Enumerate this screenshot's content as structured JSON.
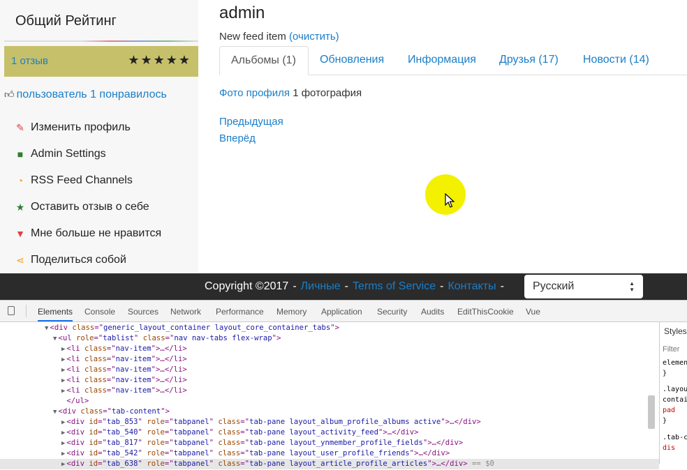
{
  "sidebar": {
    "rating_title": "Общий Рейтинг",
    "review_link": "1 отзыв",
    "stars": "★★★★★",
    "likes_text": "пользователь 1 понравилось",
    "menu": [
      {
        "label": "Изменить профиль",
        "icon": "edit-icon",
        "glyph": "✎",
        "color": "#e04040"
      },
      {
        "label": "Admin Settings",
        "icon": "admin-settings-icon",
        "glyph": "■",
        "color": "#2e7d32"
      },
      {
        "label": "RSS Feed Channels",
        "icon": "rss-icon",
        "glyph": "◔",
        "color": "#f0a020"
      },
      {
        "label": "Оставить отзыв о себе",
        "icon": "star-icon",
        "glyph": "★",
        "color": "#2e7d32"
      },
      {
        "label": "Мне больше не нравится",
        "icon": "thumbs-down-icon",
        "glyph": "▼",
        "color": "#e04040"
      },
      {
        "label": "Поделиться собой",
        "icon": "share-icon",
        "glyph": "⋖",
        "color": "#f0a020"
      }
    ]
  },
  "main": {
    "username": "admin",
    "feed_text": "New feed item",
    "feed_clear": "(очистить)",
    "tabs": [
      "Альбомы (1)",
      "Обновления",
      "Информация",
      "Друзья (17)",
      "Новости (14)"
    ],
    "active_tab": 0,
    "photos_link": "Фото профиля",
    "photos_count": "1 фотография",
    "prev": "Предыдущая",
    "next": "Вперёд"
  },
  "footer": {
    "copyright": "Copyright ©2017",
    "links": [
      "Личные",
      "Terms of Service",
      "Контакты"
    ],
    "language": "Русский"
  },
  "devtools": {
    "tabs": [
      "Elements",
      "Console",
      "Sources",
      "Network",
      "Performance",
      "Memory",
      "Application",
      "Security",
      "Audits",
      "EditThisCookie",
      "Vue"
    ],
    "active_tab": "Elements",
    "dom_lines": [
      {
        "indent": 0,
        "tri": "▼",
        "tag": "div",
        "attrs": [
          [
            "class",
            "generic_layout_container layout_core_container_tabs"
          ]
        ],
        "close": false,
        "ellipsis": false,
        "selected": false
      },
      {
        "indent": 1,
        "tri": "▼",
        "tag": "ul",
        "attrs": [
          [
            "role",
            "tablist"
          ],
          [
            "class",
            "nav nav-tabs flex-wrap"
          ]
        ],
        "close": false,
        "ellipsis": false,
        "selected": false
      },
      {
        "indent": 2,
        "tri": "▶",
        "tag": "li",
        "attrs": [
          [
            "class",
            "nav-item"
          ]
        ],
        "close": true,
        "ellipsis": true,
        "selected": false
      },
      {
        "indent": 2,
        "tri": "▶",
        "tag": "li",
        "attrs": [
          [
            "class",
            "nav-item"
          ]
        ],
        "close": true,
        "ellipsis": true,
        "selected": false
      },
      {
        "indent": 2,
        "tri": "▶",
        "tag": "li",
        "attrs": [
          [
            "class",
            "nav-item"
          ]
        ],
        "close": true,
        "ellipsis": true,
        "selected": false
      },
      {
        "indent": 2,
        "tri": "▶",
        "tag": "li",
        "attrs": [
          [
            "class",
            "nav-item"
          ]
        ],
        "close": true,
        "ellipsis": true,
        "selected": false
      },
      {
        "indent": 2,
        "tri": "▶",
        "tag": "li",
        "attrs": [
          [
            "class",
            "nav-item"
          ]
        ],
        "close": true,
        "ellipsis": true,
        "selected": false
      },
      {
        "indent": 2,
        "tri": "",
        "raw": "</ul>",
        "selected": false
      },
      {
        "indent": 1,
        "tri": "▼",
        "tag": "div",
        "attrs": [
          [
            "class",
            "tab-content"
          ]
        ],
        "close": false,
        "ellipsis": false,
        "selected": false
      },
      {
        "indent": 2,
        "tri": "▶",
        "tag": "div",
        "attrs": [
          [
            "id",
            "tab_853"
          ],
          [
            "role",
            "tabpanel"
          ],
          [
            "class",
            "tab-pane layout_album_profile_albums active"
          ]
        ],
        "close": true,
        "ellipsis": true,
        "selected": false
      },
      {
        "indent": 2,
        "tri": "▶",
        "tag": "div",
        "attrs": [
          [
            "id",
            "tab_540"
          ],
          [
            "role",
            "tabpanel"
          ],
          [
            "class",
            "tab-pane layout_activity_feed"
          ]
        ],
        "close": true,
        "ellipsis": true,
        "selected": false
      },
      {
        "indent": 2,
        "tri": "▶",
        "tag": "div",
        "attrs": [
          [
            "id",
            "tab_817"
          ],
          [
            "role",
            "tabpanel"
          ],
          [
            "class",
            "tab-pane layout_ynmember_profile_fields"
          ]
        ],
        "close": true,
        "ellipsis": true,
        "selected": false
      },
      {
        "indent": 2,
        "tri": "▶",
        "tag": "div",
        "attrs": [
          [
            "id",
            "tab_542"
          ],
          [
            "role",
            "tabpanel"
          ],
          [
            "class",
            "tab-pane layout_user_profile_friends"
          ]
        ],
        "close": true,
        "ellipsis": true,
        "selected": false
      },
      {
        "indent": 2,
        "tri": "▶",
        "tag": "div",
        "attrs": [
          [
            "id",
            "tab_638"
          ],
          [
            "role",
            "tabpanel"
          ],
          [
            "class",
            "tab-pane layout_article_profile_articles"
          ]
        ],
        "close": true,
        "ellipsis": true,
        "selected": true,
        "suffix": " == $0"
      }
    ],
    "styles": {
      "tab": "Styles",
      "filter": "Filter",
      "lines": [
        "element",
        "}",
        ".layout",
        "contain",
        "  pad",
        "}",
        ".tab-c",
        "  dis"
      ]
    }
  }
}
